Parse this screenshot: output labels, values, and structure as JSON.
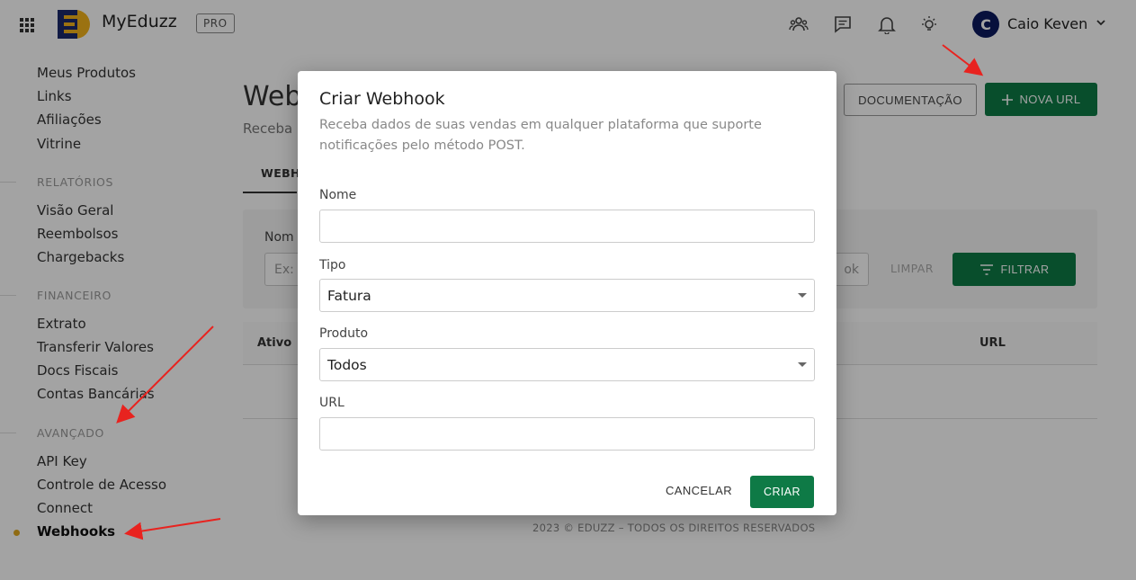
{
  "topbar": {
    "brand": "MyEduzz",
    "plan_badge": "PRO",
    "icons": [
      "apps-grid-icon",
      "users-icon",
      "chat-icon",
      "bell-icon",
      "lightbulb-icon"
    ],
    "user_initial": "C",
    "user_name": "Caio Keven"
  },
  "sidebar": {
    "items_top": [
      "Meus Produtos",
      "Links",
      "Afiliações",
      "Vitrine"
    ],
    "relatorios": {
      "header": "RELATÓRIOS",
      "items": [
        "Visão Geral",
        "Reembolsos",
        "Chargebacks"
      ]
    },
    "financeiro": {
      "header": "FINANCEIRO",
      "items": [
        "Extrato",
        "Transferir Valores",
        "Docs Fiscais",
        "Contas Bancárias"
      ]
    },
    "avancado": {
      "header": "AVANÇADO",
      "items": [
        "API Key",
        "Controle de Acesso",
        "Connect",
        "Webhooks"
      ]
    },
    "active_item": "Webhooks"
  },
  "page": {
    "title": "Web",
    "subtitle": "Receba",
    "doc_button": "DOCUMENTAÇÃO",
    "nova_url_button": "NOVA URL",
    "tab": "WEBH",
    "filter": {
      "label": "Nom",
      "placeholder": "Ex:",
      "suffix": "ok",
      "clear": "LIMPAR",
      "filter_button": "FILTRAR"
    },
    "table_headers": {
      "ativo": "Ativo",
      "url": "URL"
    },
    "footer": "2023 © EDUZZ – TODOS OS DIREITOS RESERVADOS"
  },
  "modal": {
    "title": "Criar Webhook",
    "description": "Receba dados de suas vendas em qualquer plataforma que suporte notificações pelo método POST.",
    "fields": {
      "nome": {
        "label": "Nome",
        "value": ""
      },
      "tipo": {
        "label": "Tipo",
        "value": "Fatura"
      },
      "produto": {
        "label": "Produto",
        "value": "Todos"
      },
      "url": {
        "label": "URL",
        "value": ""
      }
    },
    "cancel": "CANCELAR",
    "submit": "CRIAR"
  },
  "colors": {
    "accent_green": "#0e7a46",
    "avatar_bg": "#0b1a5e",
    "active_dot": "#e0a81f",
    "annotation_arrow": "#e8231f"
  }
}
